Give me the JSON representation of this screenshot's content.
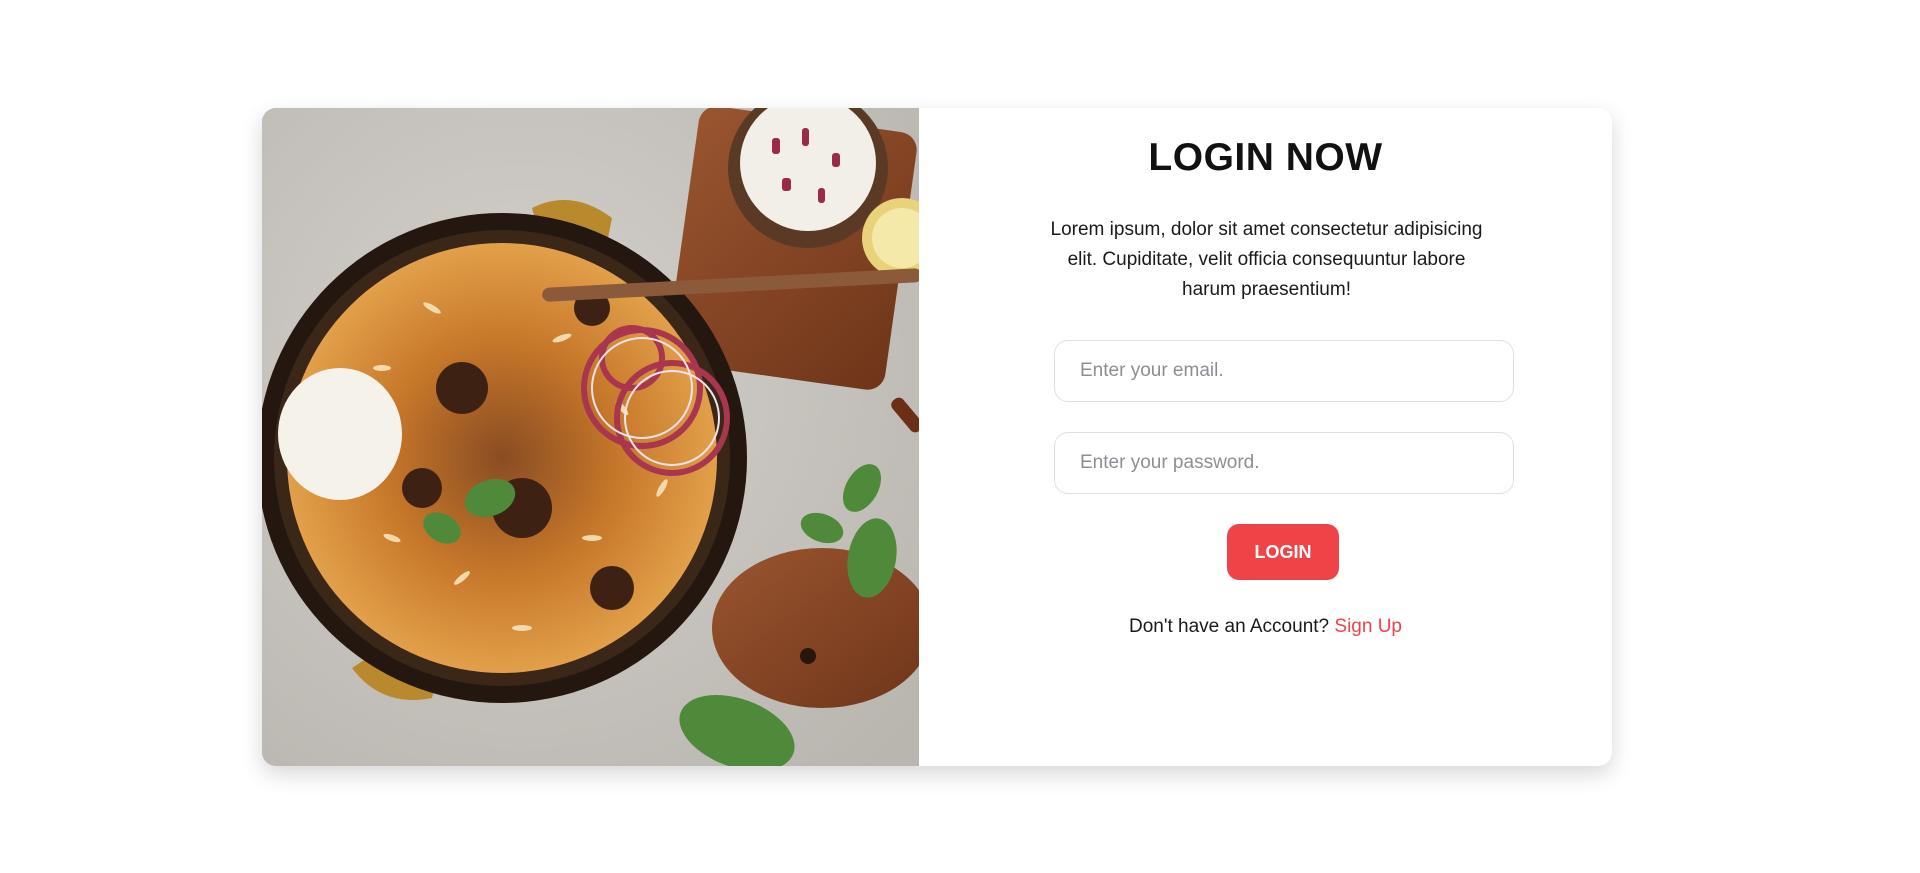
{
  "hero_image": {
    "description_icon": "biryani-photo",
    "colors": {
      "background": "#c9c6c1",
      "pot": "#2a1d14",
      "rice": "#d98b2b",
      "onion": "#a8364f",
      "egg": "#f5f2ea",
      "mint": "#4e8a3a",
      "board": "#8a4a2a"
    }
  },
  "form": {
    "title": "LOGIN NOW",
    "description": "Lorem ipsum, dolor sit amet consectetur adipisicing elit. Cupiditate, velit officia consequuntur labore harum praesentium!",
    "email_placeholder": "Enter your email.",
    "email_value": "",
    "password_placeholder": "Enter your password.",
    "password_value": "",
    "login_label": "LOGIN",
    "signup_prompt": "Don't have an Account?",
    "signup_link": "Sign Up"
  },
  "theme": {
    "accent": "#ef4447",
    "text": "#1a1a1a",
    "placeholder": "#8b8f94"
  }
}
